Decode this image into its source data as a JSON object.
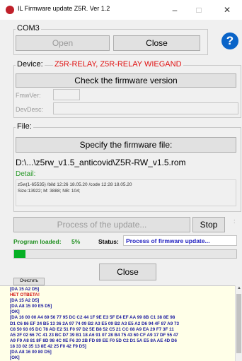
{
  "window": {
    "title": "IL Firmware update Z5R. Ver 1.2",
    "minimize": "–",
    "maximize": "□",
    "close": "✕"
  },
  "com": {
    "label": "COM3",
    "open_label": "Open",
    "close_label": "Close",
    "help_label": "?"
  },
  "device": {
    "label": "Device:",
    "name": "Z5R-RELAY, Z5R-RELAY WIEGAND",
    "check_label": "Check the firmware version",
    "fmw_label": "FmwVer:",
    "dev_label": "DevDesc:"
  },
  "file": {
    "label": "File:",
    "specify_label": "Specify the firmware file:",
    "path": "D:\\...\\z5rw_v1.5_anticovid\\Z5R-RW_v1.5.rom",
    "detail_label": "Detail:",
    "detail_lines": [
      "z5w(1-65535) /bild 12:26 18.05.20 /code 12:28 18.05.20",
      "Size:13922; M: 3888; NB: 104;"
    ]
  },
  "update": {
    "process_label": "Process of the update...",
    "stop_label": "Stop",
    "loaded_label": "Program loaded:",
    "loaded_value": "5%",
    "status_label": "Status:",
    "status_value": "Process of firmware update...",
    "progress": 0.05,
    "close_label": "Close"
  },
  "log": {
    "clear_label": "Очистить",
    "lines": [
      {
        "text": "[DA 15 A2 D5]",
        "color": "#1a1aa0"
      },
      {
        "text": "НЕТ ОТВЕТА!",
        "color": "#d01010"
      },
      {
        "text": "[DA 15 A2 D5]",
        "color": "#1a1aa0"
      },
      {
        "text": "[DA A8 15 00 E5 D5]",
        "color": "#1a1aa0"
      },
      {
        "text": "[OK]",
        "color": "#1a1aa0"
      },
      {
        "text": "[DA 16 00 00 A4 69 56 77 95 DC C2 44 1F 9E E3 5F E4 EF AA 99 8B C1 38 8E 98",
        "color": "#1a1aa0"
      },
      {
        "text": "D1 C6 86 EF 24 B5 13 36 2A 97 74 09 B2 A3 E5 09 B2 A3 E5 A2 D6 94 4F 87 A9 73",
        "color": "#1a1aa0"
      },
      {
        "text": "C8 50 93 05 DC 78 AD E2 51 F0 97 D2 5E B8 52 C5 21 CC 08 A9 EA 29 F7 3F 11",
        "color": "#1a1aa0"
      },
      {
        "text": "A5 2F 02 66 7C 41 23 BC D7 39 B1 18 A6 91 07 28 B4 75 43 60 CF A9 17 DF 55 47",
        "color": "#1a1aa0"
      },
      {
        "text": "A9 F9 A8 81 8F 8D 98 4C 0E F6 20 2B FD 89 EE F0 5D C2 D1 5A E5 8A AE 4D D6",
        "color": "#1a1aa0"
      },
      {
        "text": "18 33 02 35 13 8E 42 25 F0 42 F9 D5]",
        "color": "#1a1aa0"
      },
      {
        "text": "[DA A8 16 00 80 D5]",
        "color": "#1a1aa0"
      },
      {
        "text": "[OK]",
        "color": "#1a1aa0"
      }
    ]
  },
  "colors": {
    "device_name": "#e01010",
    "detail_label": "#2a9a2a",
    "loaded": "#1f8f1f",
    "status_text": "#2020c0",
    "progress_fill": "#06b025",
    "help_bg": "#0a64c8",
    "log_bg": "#ffffe8"
  }
}
